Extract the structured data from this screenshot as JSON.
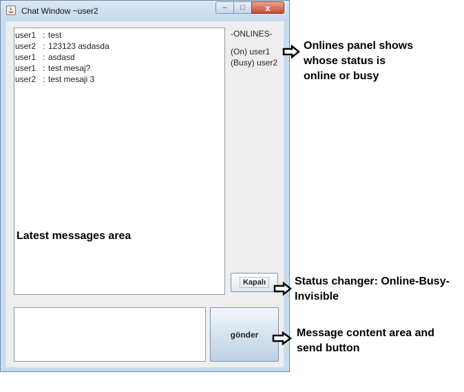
{
  "window": {
    "title": "Chat Window ~user2",
    "min_label": "–",
    "max_label": "□",
    "close_label": "x"
  },
  "messages": [
    {
      "user": "user1",
      "sep": ":",
      "text": "test"
    },
    {
      "user": "user2",
      "sep": ":",
      "text": "123123 asdasda"
    },
    {
      "user": "user1",
      "sep": ":",
      "text": "asdasd"
    },
    {
      "user": "user1",
      "sep": ":",
      "text": "test mesaj?"
    },
    {
      "user": "user2",
      "sep": ":",
      "text": "test mesaji 3"
    }
  ],
  "onlines": {
    "title": "-ONLINES-",
    "items": [
      "(On) user1",
      "(Busy) user2"
    ]
  },
  "status_button": {
    "label": "Kapalı"
  },
  "send_button": {
    "label": "gönder"
  },
  "annotations": {
    "onlines": [
      "Onlines panel shows",
      "whose status is",
      "online or busy"
    ],
    "messages": "Latest messages area",
    "status": [
      "Status changer: Online-Busy-",
      "Invisible"
    ],
    "send": [
      "Message content area and",
      "send button"
    ]
  }
}
